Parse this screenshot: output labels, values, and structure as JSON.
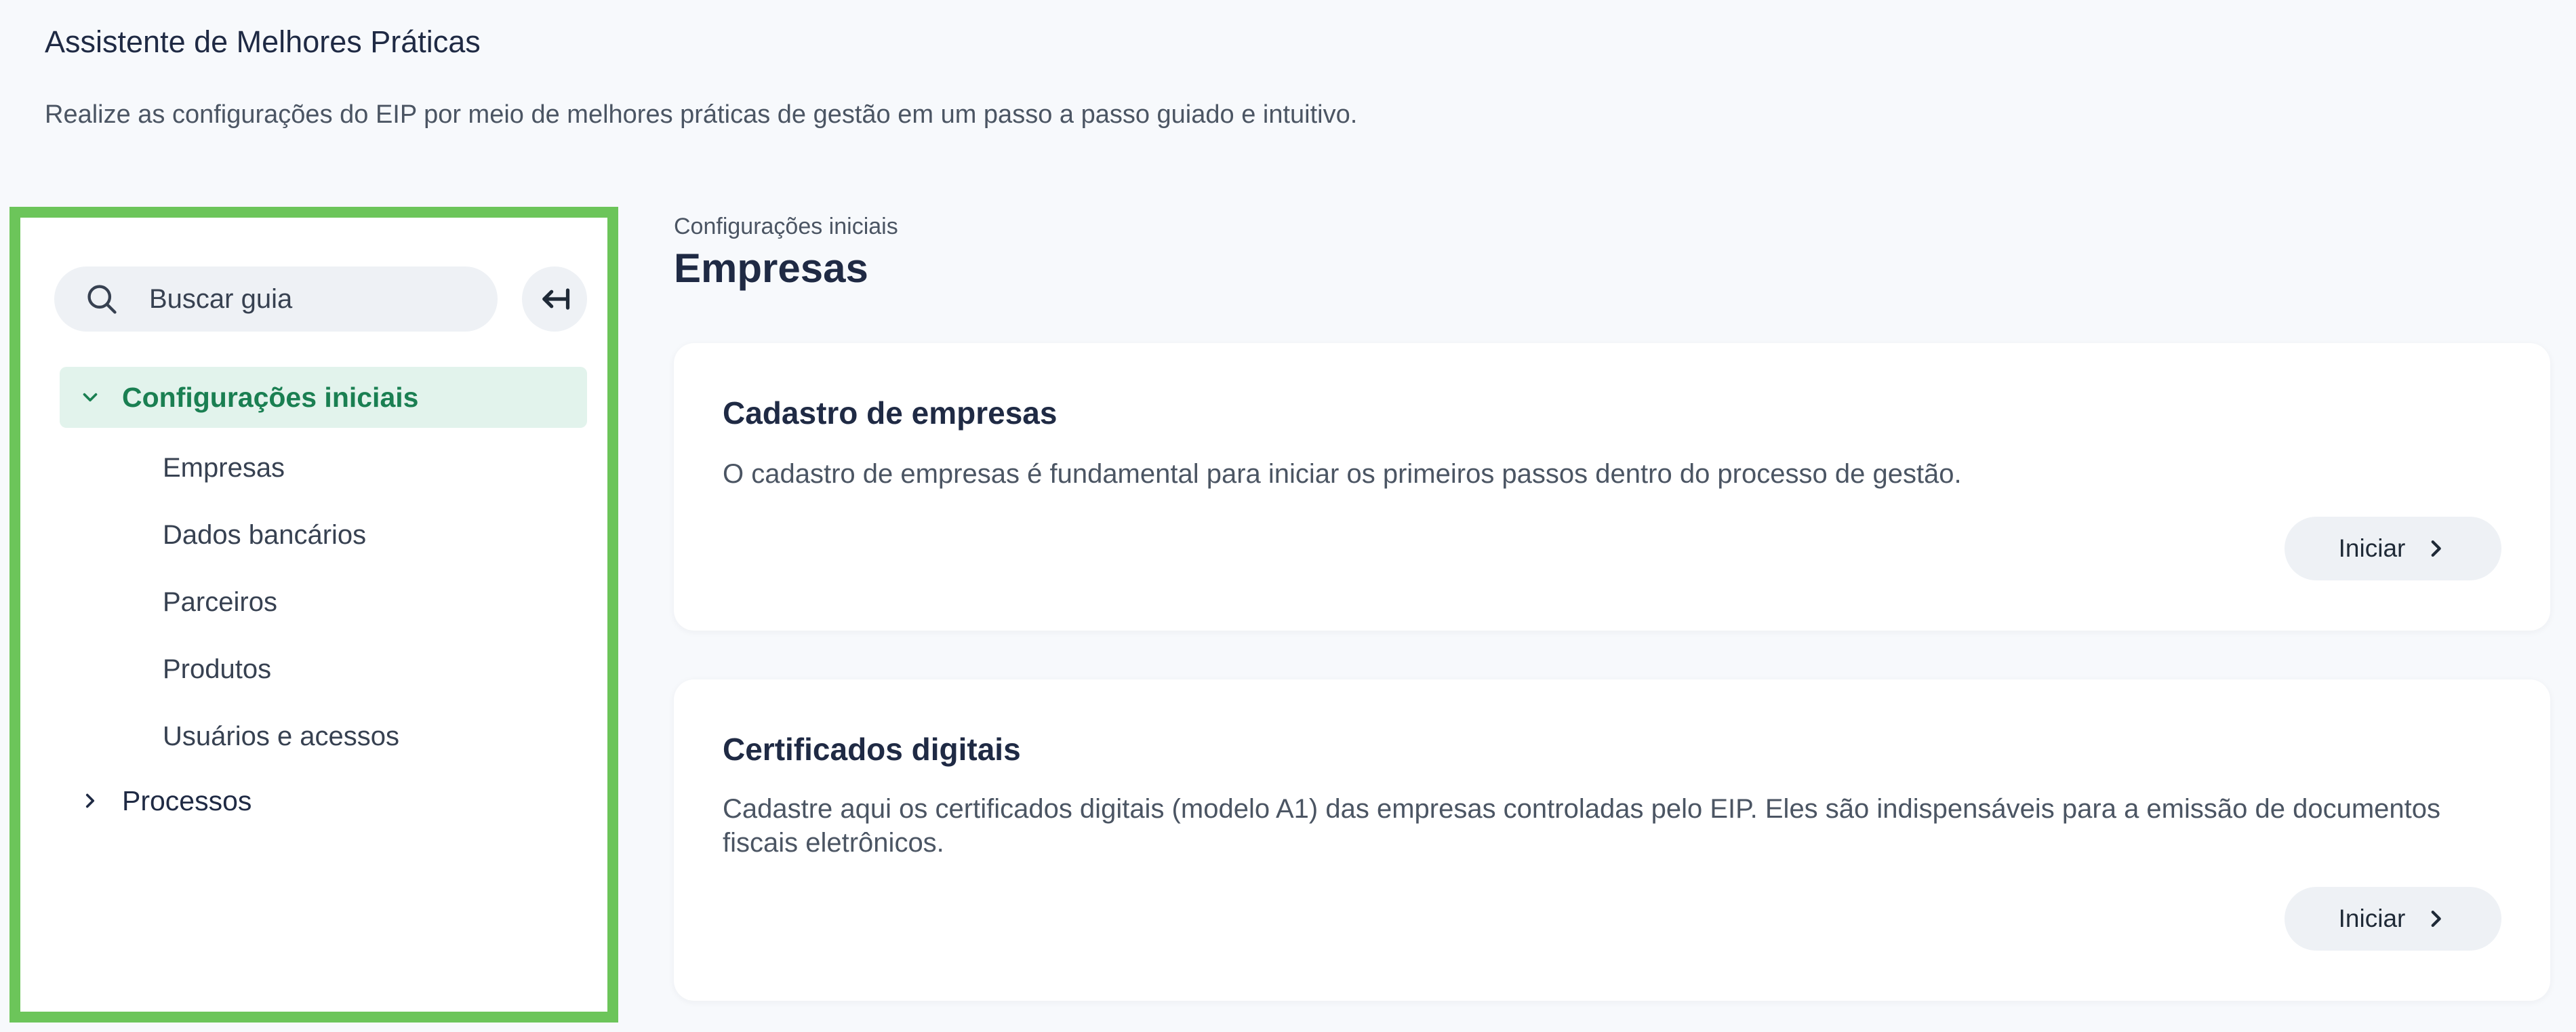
{
  "header": {
    "title": "Assistente de Melhores Práticas",
    "subtitle": "Realize as configurações do EIP por meio de melhores práticas de gestão em um passo a passo guiado e intuitivo."
  },
  "sidebar": {
    "search": {
      "placeholder": "Buscar guia",
      "icon": "search-icon"
    },
    "collapse_icon": "collapse-left-icon",
    "groups": [
      {
        "label": "Configurações iniciais",
        "expanded": true,
        "items": [
          {
            "label": "Empresas"
          },
          {
            "label": "Dados bancários"
          },
          {
            "label": "Parceiros"
          },
          {
            "label": "Produtos"
          },
          {
            "label": "Usuários e acessos"
          }
        ]
      },
      {
        "label": "Processos",
        "expanded": false,
        "items": []
      }
    ]
  },
  "main": {
    "breadcrumb": "Configurações iniciais",
    "title": "Empresas",
    "cards": [
      {
        "title": "Cadastro de empresas",
        "description": "O cadastro de empresas é fundamental para iniciar os primeiros passos dentro do processo de gestão.",
        "button_label": "Iniciar"
      },
      {
        "title": "Certificados digitais",
        "description": "Cadastre aqui os certificados digitais (modelo A1) das empresas controladas pelo EIP. Eles são indispensáveis para a emissão de documentos fiscais eletrônicos.",
        "button_label": "Iniciar"
      }
    ]
  },
  "colors": {
    "accent_green": "#1a7f52",
    "active_bg": "#e2f3ec",
    "highlight_border": "#6cc55a",
    "page_bg": "#f7f9fc"
  }
}
